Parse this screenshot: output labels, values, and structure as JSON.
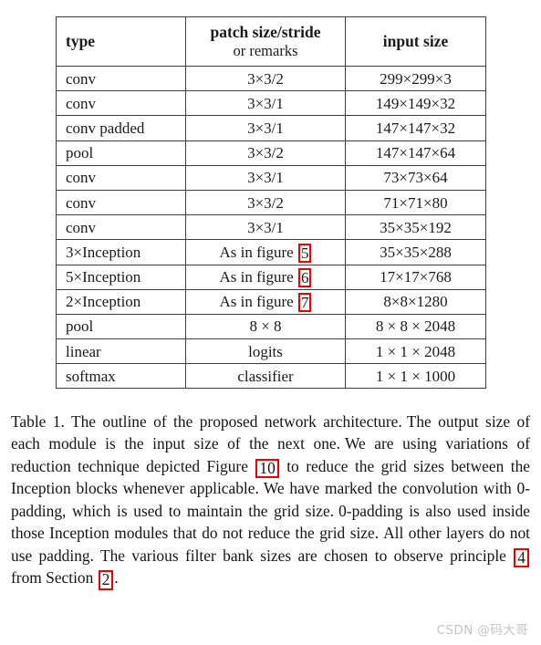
{
  "table": {
    "headers": {
      "type": "type",
      "patch_line1": "patch size/stride",
      "patch_line2": "or remarks",
      "input": "input size"
    },
    "rows": [
      {
        "type": "conv",
        "patch": "3×3/2",
        "ref": null,
        "input": "299×299×3"
      },
      {
        "type": "conv",
        "patch": "3×3/1",
        "ref": null,
        "input": "149×149×32"
      },
      {
        "type": "conv padded",
        "patch": "3×3/1",
        "ref": null,
        "input": "147×147×32"
      },
      {
        "type": "pool",
        "patch": "3×3/2",
        "ref": null,
        "input": "147×147×64"
      },
      {
        "type": "conv",
        "patch": "3×3/1",
        "ref": null,
        "input": "73×73×64"
      },
      {
        "type": "conv",
        "patch": "3×3/2",
        "ref": null,
        "input": "71×71×80"
      },
      {
        "type": "conv",
        "patch": "3×3/1",
        "ref": null,
        "input": "35×35×192"
      },
      {
        "type": "3×Inception",
        "patch": "As in figure ",
        "ref": "5",
        "input": "35×35×288"
      },
      {
        "type": "5×Inception",
        "patch": "As in figure ",
        "ref": "6",
        "input": "17×17×768"
      },
      {
        "type": "2×Inception",
        "patch": "As in figure ",
        "ref": "7",
        "input": "8×8×1280"
      },
      {
        "type": "pool",
        "patch": "8 × 8",
        "ref": null,
        "input": "8 × 8 × 2048"
      },
      {
        "type": "linear",
        "patch": "logits",
        "ref": null,
        "input": "1 × 1 × 2048"
      },
      {
        "type": "softmax",
        "patch": "classifier",
        "ref": null,
        "input": "1 × 1 × 1000"
      }
    ]
  },
  "caption": {
    "part1": "Table 1. The outline of the proposed network architecture.",
    "part2": "The output size of each module is the input size of the next one.",
    "part3": "We are using variations of reduction technique depicted Figure",
    "ref_figure": "10",
    "part4": "to reduce the grid sizes between the Inception blocks whenever applicable.",
    "part5": "We have marked the convolution with 0-padding, which is used to maintain the grid size.",
    "part6": "0-padding is also used inside those Inception modules that do not reduce the grid size.",
    "part7": "All other layers do not use padding. The various filter bank sizes are chosen to observe principle",
    "ref_principle": "4",
    "part8": "from Section",
    "ref_section": "2",
    "part9": "."
  },
  "watermark": {
    "text": "CSDN @码大哥"
  },
  "colors": {
    "annotation_red": "#ee0000",
    "table_border": "#3d3d3d",
    "text": "#141414",
    "watermark": "#c3c3c3",
    "background": "#ffffff"
  }
}
